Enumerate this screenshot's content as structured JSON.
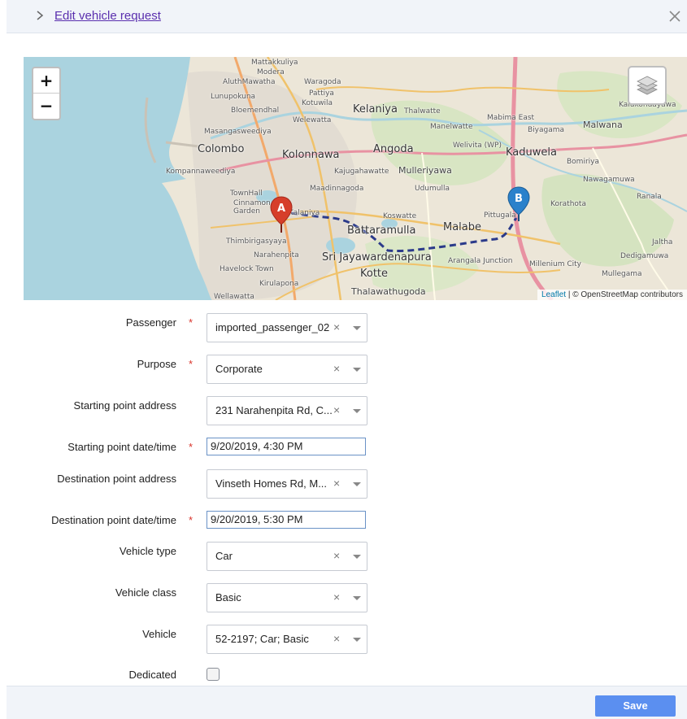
{
  "header": {
    "title": "Edit vehicle request",
    "chevron_icon": "chevron-right-icon",
    "close_icon": "close-icon"
  },
  "map": {
    "zoom_in": "+",
    "zoom_out": "−",
    "layers_icon": "layers-icon",
    "attribution_link": "Leaflet",
    "attribution_text": " | © OpenStreetMap contributors",
    "markers": [
      {
        "label": "A",
        "color": "#d63e2a"
      },
      {
        "label": "B",
        "color": "#2a81cb"
      }
    ],
    "places": [
      "Mattakkuliya",
      "Modera",
      "AluthMawatha",
      "Waragoda",
      "Pattiya",
      "Lunupokuna",
      "Kotuwila",
      "Kelaniya",
      "Thalwatte",
      "Bloemendhal",
      "Welewatta",
      "Masangasweediya",
      "Manelwatte",
      "Colombo",
      "Kolonnawa",
      "Angoda",
      "Kompannaweediya",
      "Kajugahawatte",
      "Mulleriyawa",
      "TownHall",
      "Maadinnagoda",
      "Udumulla",
      "Cinnamon Garden",
      "Kalaniya",
      "Koswatte",
      "Battaramulla",
      "Malabe",
      "Pittugala",
      "Thimbirigasyaya",
      "Narahenpita",
      "Sri Jayawardenapura",
      "Kotte",
      "Arangala Junction",
      "Havelock Town",
      "Kirulapona",
      "Thalawathugoda",
      "Wellawatta",
      "Mabima East",
      "Biyagama",
      "Malwana",
      "Welivita (WP)",
      "Kaduwela",
      "Bomiriya",
      "Nawagamuwa",
      "Korathota",
      "Ranala",
      "Millenium City",
      "Dedigamuwa",
      "Mullegama",
      "Kalukondayawa",
      "Jaltha"
    ]
  },
  "form": {
    "passenger": {
      "label": "Passenger",
      "required": "*",
      "value": "imported_passenger_02"
    },
    "purpose": {
      "label": "Purpose",
      "required": "*",
      "value": "Corporate"
    },
    "start_address": {
      "label": "Starting point address",
      "value": "231 Narahenpita Rd, C..."
    },
    "start_datetime": {
      "label": "Starting point date/time",
      "required": "*",
      "value": "9/20/2019, 4:30 PM"
    },
    "dest_address": {
      "label": "Destination point address",
      "value": "Vinseth Homes Rd, M..."
    },
    "dest_datetime": {
      "label": "Destination point date/time",
      "required": "*",
      "value": "9/20/2019, 5:30 PM"
    },
    "vehicle_type": {
      "label": "Vehicle type",
      "value": "Car"
    },
    "vehicle_class": {
      "label": "Vehicle class",
      "value": "Basic"
    },
    "vehicle": {
      "label": "Vehicle",
      "value": "52-2197; Car; Basic"
    },
    "dedicated": {
      "label": "Dedicated",
      "checked": false
    },
    "clear_symbol": "×"
  },
  "footer": {
    "save_label": "Save"
  },
  "colors": {
    "accent": "#5b8ff0",
    "link": "#5a2fae",
    "required": "#d9342b",
    "header_bg": "#f1f4f9"
  }
}
